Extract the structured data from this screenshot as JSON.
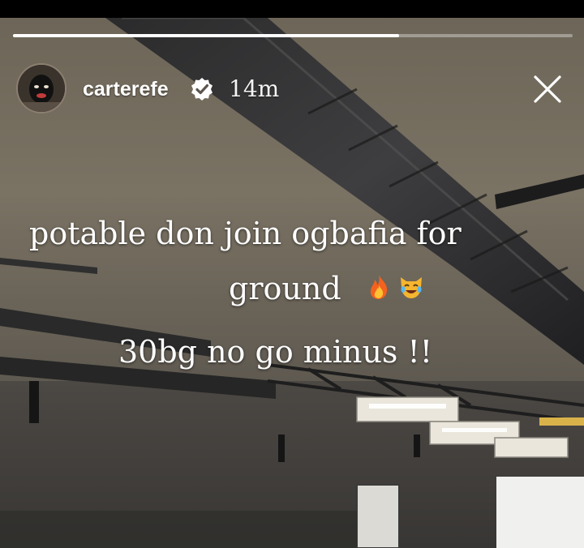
{
  "story": {
    "progress_fraction": 0.69,
    "username": "carterefe",
    "timestamp": "14m",
    "caption_lines": [
      "potable don join ogbafia  for",
      "ground",
      "30bg no go minus !!"
    ]
  },
  "icons": {
    "verified": "verified-badge-icon",
    "close": "close-icon",
    "emoji_1": "fire-emoji",
    "emoji_2": "cat-tears-of-joy-emoji"
  },
  "colors": {
    "progress_active": "#ffffff",
    "progress_track": "rgba(255,255,255,0.35)",
    "text": "#ffffff"
  }
}
